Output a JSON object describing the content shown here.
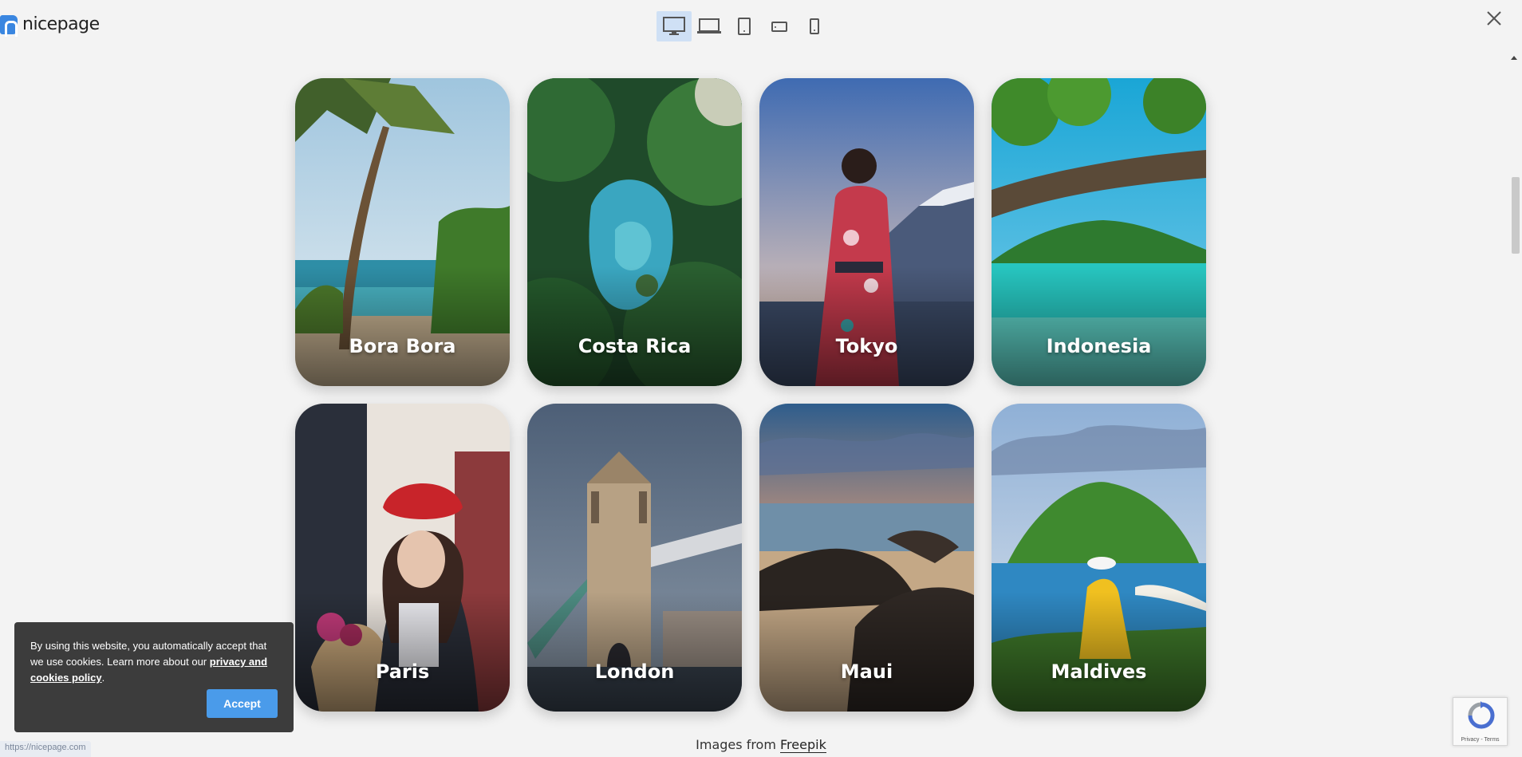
{
  "header": {
    "logo_text": "nicepage",
    "devices": [
      {
        "name": "desktop",
        "active": true
      },
      {
        "name": "laptop",
        "active": false
      },
      {
        "name": "tablet",
        "active": false
      },
      {
        "name": "phone-landscape",
        "active": false
      },
      {
        "name": "phone",
        "active": false
      }
    ]
  },
  "cards": [
    {
      "label": "Bora Bora"
    },
    {
      "label": "Costa Rica"
    },
    {
      "label": "Tokyo"
    },
    {
      "label": "Indonesia"
    },
    {
      "label": "Paris"
    },
    {
      "label": "London"
    },
    {
      "label": "Maui"
    },
    {
      "label": "Maldives"
    }
  ],
  "credit": {
    "prefix": "Images from",
    "link": "Freepik"
  },
  "cookie": {
    "text": "By using this website, you automatically accept that we use cookies. Learn more about our",
    "link": "privacy and cookies policy",
    "suffix": ".",
    "accept": "Accept"
  },
  "status_url": "https://nicepage.com",
  "recaptcha": {
    "terms": "Privacy - Terms"
  },
  "colors": {
    "accent": "#4a9bea",
    "brand": "#3a86e0",
    "cookie_bg": "#3c3c3c"
  }
}
